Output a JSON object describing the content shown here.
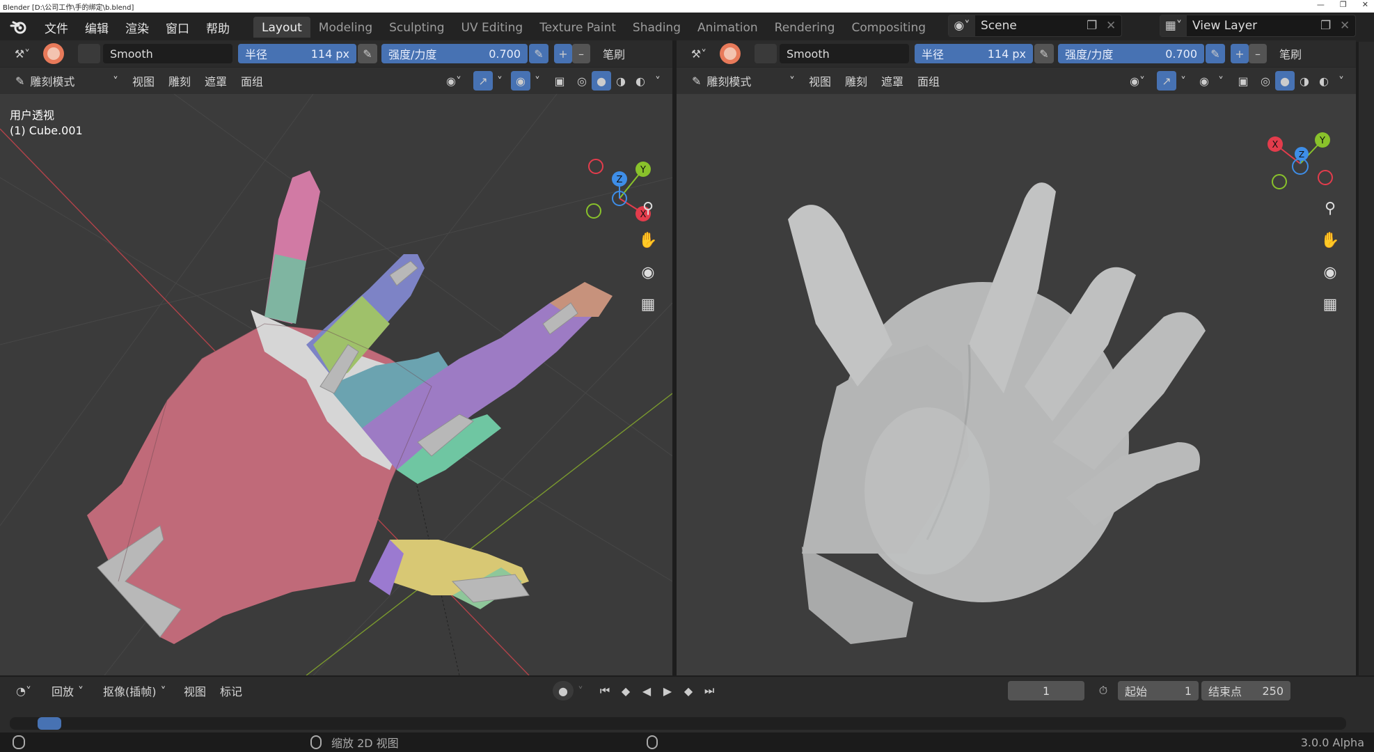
{
  "titlebar": {
    "title": "Blender [D:\\公司工作\\手的绑定\\b.blend]"
  },
  "menu": {
    "file": "文件",
    "edit": "编辑",
    "render": "渲染",
    "window": "窗口",
    "help": "帮助"
  },
  "workspaces": [
    "Layout",
    "Modeling",
    "Sculpting",
    "UV Editing",
    "Texture Paint",
    "Shading",
    "Animation",
    "Rendering",
    "Compositing"
  ],
  "scene": {
    "label": "Scene"
  },
  "view_layer": {
    "label": "View Layer"
  },
  "left_view": {
    "brush_name": "Smooth",
    "radius_label": "半径",
    "radius_value": "114 px",
    "strength_label": "强度/力度",
    "strength_value": "0.700",
    "brush_menu": "笔刷",
    "mode_label": "雕刻模式",
    "menus": [
      "视图",
      "雕刻",
      "遮罩",
      "面组"
    ],
    "overlay_title": "用户透视",
    "overlay_object": "(1) Cube.001"
  },
  "right_view": {
    "brush_name": "Smooth",
    "radius_label": "半径",
    "radius_value": "114 px",
    "strength_label": "强度/力度",
    "strength_value": "0.700",
    "brush_menu": "笔刷",
    "mode_label": "雕刻模式",
    "menus": [
      "视图",
      "雕刻",
      "遮罩",
      "面组"
    ]
  },
  "axes": {
    "x": "X",
    "y": "Y",
    "z": "Z"
  },
  "timeline": {
    "playback": "回放",
    "keying": "抠像(插帧)",
    "view": "视图",
    "marker": "标记",
    "current_frame": "1",
    "start_label": "起始",
    "start_value": "1",
    "end_label": "结束点",
    "end_value": "250"
  },
  "statusbar": {
    "hint": "缩放 2D 视图",
    "version": "3.0.0 Alpha"
  },
  "colors": {
    "accent": "#4772b3",
    "axis_x": "#e33c4c",
    "axis_y": "#89c22b",
    "axis_z": "#3e8ee8"
  }
}
